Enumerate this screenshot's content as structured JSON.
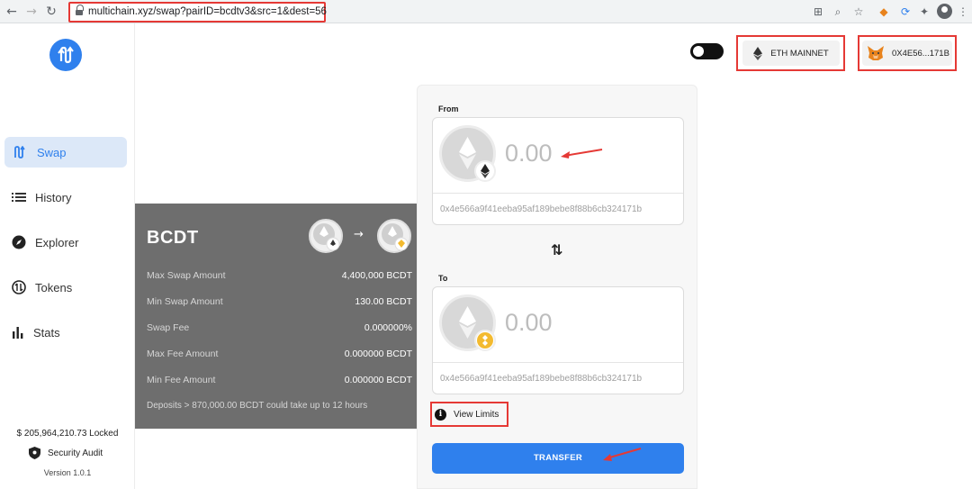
{
  "browser": {
    "url": "multichain.xyz/swap?pairID=bcdtv3&src=1&dest=56"
  },
  "sidebar": {
    "items": [
      {
        "label": "Swap",
        "icon": "swap-icon",
        "active": true
      },
      {
        "label": "History",
        "icon": "list-icon",
        "active": false
      },
      {
        "label": "Explorer",
        "icon": "compass-icon",
        "active": false
      },
      {
        "label": "Tokens",
        "icon": "token-icon",
        "active": false
      },
      {
        "label": "Stats",
        "icon": "bar-chart-icon",
        "active": false
      }
    ],
    "locked": "$ 205,964,210.73 Locked",
    "audit": "Security Audit",
    "version": "Version 1.0.1"
  },
  "header": {
    "network": "ETH MAINNET",
    "account": "0X4E56...171B"
  },
  "info": {
    "token": "BCDT",
    "rows": [
      {
        "k": "Max Swap Amount",
        "v": "4,400,000 BCDT"
      },
      {
        "k": "Min Swap Amount",
        "v": "130.00 BCDT"
      },
      {
        "k": "Swap Fee",
        "v": "0.000000%"
      },
      {
        "k": "Max Fee Amount",
        "v": "0.000000 BCDT"
      },
      {
        "k": "Min Fee Amount",
        "v": "0.000000 BCDT"
      }
    ],
    "note": "Deposits > 870,000.00 BCDT could take up to 12 hours"
  },
  "swap": {
    "from": {
      "label": "From",
      "amount": "0.00",
      "address": "0x4e566a9f41eeba95af189bebe8f88b6cb324171b"
    },
    "to": {
      "label": "To",
      "amount": "0.00",
      "address": "0x4e566a9f41eeba95af189bebe8f88b6cb324171b"
    },
    "view_limits": "View Limits",
    "transfer": "TRANSFER"
  },
  "colors": {
    "accent": "#2f80ed",
    "highlight": "#e53935",
    "card": "#6e6e6e"
  }
}
